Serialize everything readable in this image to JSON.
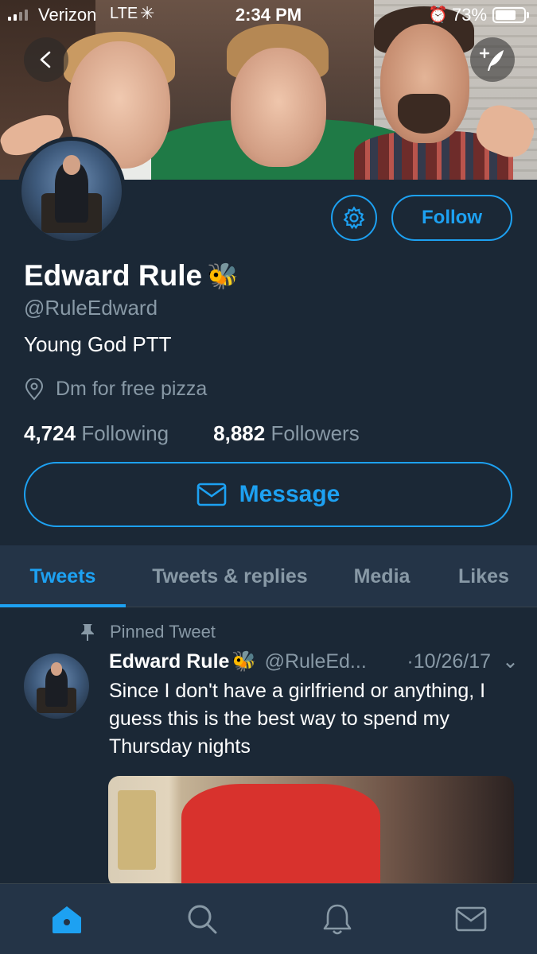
{
  "status_bar": {
    "carrier": "Verizon",
    "network": "LTE",
    "loading_glyph": "✳",
    "time": "2:34 PM",
    "alarm_glyph": "⏰",
    "battery_percent": "73%",
    "battery_level": 0.73
  },
  "profile": {
    "display_name": "Edward Rule",
    "name_emoji": "🐝",
    "handle": "@RuleEdward",
    "bio": "Young God PTT",
    "location": "Dm for free pizza",
    "following_count": "4,724",
    "following_label": "Following",
    "followers_count": "8,882",
    "followers_label": "Followers"
  },
  "actions": {
    "follow_label": "Follow",
    "message_label": "Message"
  },
  "tabs": [
    {
      "label": "Tweets",
      "active": true
    },
    {
      "label": "Tweets & replies",
      "active": false
    },
    {
      "label": "Media",
      "active": false
    },
    {
      "label": "Likes",
      "active": false
    }
  ],
  "pinned_tweet": {
    "pinned_label": "Pinned Tweet",
    "author_name": "Edward Rule",
    "author_emoji": "🐝",
    "author_handle": "@RuleEd...",
    "date": "·10/26/17",
    "caret": "⌄",
    "text": "Since I don't have a girlfriend or anything, I guess this is the best way to spend my Thursday nights"
  },
  "nav": [
    {
      "icon": "home-icon",
      "active": true
    },
    {
      "icon": "search-icon",
      "active": false
    },
    {
      "icon": "notifications-bell-icon",
      "active": false
    },
    {
      "icon": "messages-envelope-icon",
      "active": false
    }
  ],
  "colors": {
    "accent": "#1da1f2",
    "background": "#1b2836",
    "tab_background": "#243447",
    "muted_text": "#8899a6"
  }
}
